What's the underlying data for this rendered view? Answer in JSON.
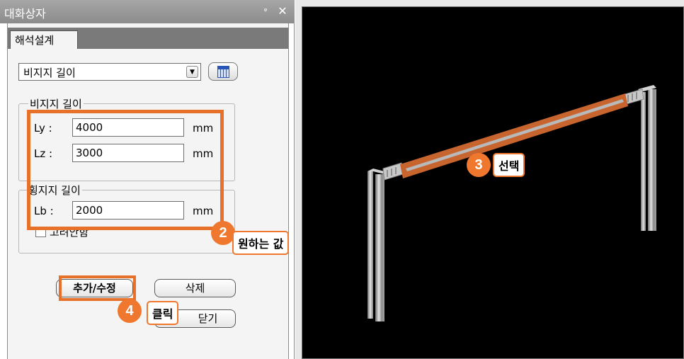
{
  "dialog": {
    "title": "대화상자",
    "pin_glyph": "ᵠ",
    "close_glyph": "✕",
    "tab": "해석설계",
    "combo_value": "비지지 길이",
    "unbraced_group_label": "비지지 길이",
    "lateral_group_label": "횡지지 길이",
    "fields": [
      {
        "label": "Ly  :",
        "value": "4000",
        "unit": "mm"
      },
      {
        "label": "Lz  :",
        "value": "3000",
        "unit": "mm"
      },
      {
        "label": "Lb  :",
        "value": "2000",
        "unit": "mm"
      }
    ],
    "ignore_label": "고려안함",
    "ignore_checked": false,
    "add_modify_button": "추가/수정",
    "delete_button": "삭제",
    "close_button": "닫기"
  },
  "annotations": [
    {
      "number": "2",
      "text": "원하는 값"
    },
    {
      "number": "3",
      "text": "선택"
    },
    {
      "number": "4",
      "text": "클릭"
    }
  ],
  "colors": {
    "accent_orange": "#f0782e",
    "viewport_bg": "#000000",
    "selected_beam": "#c8642e"
  }
}
